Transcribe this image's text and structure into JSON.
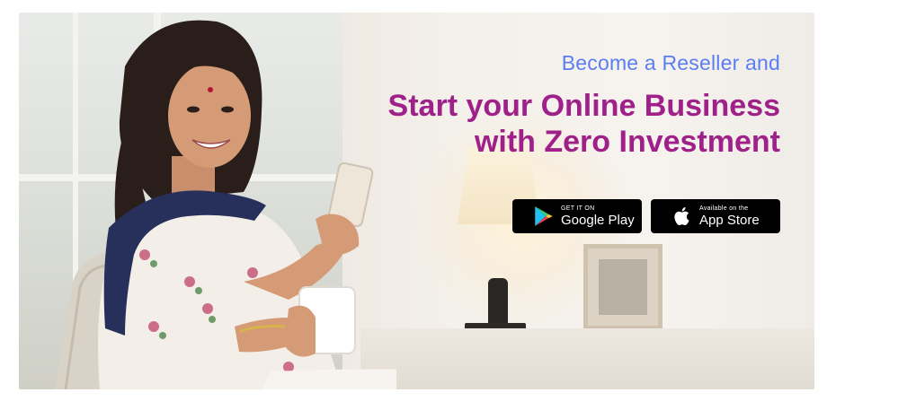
{
  "banner": {
    "subtitle": "Become a Reseller and",
    "title_line1": "Start your Online Business",
    "title_line2": "with Zero Investment",
    "colors": {
      "subtitle": "#5b7ef0",
      "title": "#9f2089",
      "store_button_bg": "#000000"
    }
  },
  "stores": {
    "google": {
      "small_text": "GET IT ON",
      "big_text": "Google Play",
      "icon": "google-play-icon"
    },
    "apple": {
      "small_text": "Available on the",
      "big_text": "App Store",
      "icon": "apple-icon"
    }
  },
  "image": {
    "subject": "woman-smiling-with-phone-and-cup"
  }
}
